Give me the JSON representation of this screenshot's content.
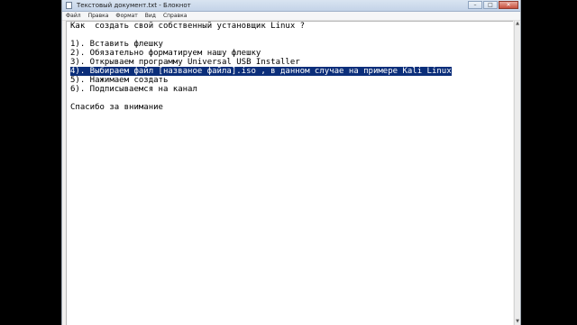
{
  "window": {
    "title": "Текстовый документ.txt - Блокнот",
    "controls": {
      "minimize": "–",
      "maximize": "□",
      "close": "✕"
    }
  },
  "menu": [
    "Файл",
    "Правка",
    "Формат",
    "Вид",
    "Справка"
  ],
  "document": {
    "lines": [
      "Как  создать свой собственный установщик Linux ?",
      "",
      "1). Вставить флешку",
      "2). Обязательно форматируем нашу флешку",
      "3). Открываем программу Universal USB Installer",
      "4). Выбираем файл [названое файла].iso , в данном случае на примере Kali Linux",
      "5). Нажимаем создать",
      "6). Подписываемся на канал",
      "",
      "Спасибо за внимание"
    ],
    "selected_line_index": 5
  },
  "colors": {
    "selection": "#0b2e7a",
    "background": "#000000"
  }
}
